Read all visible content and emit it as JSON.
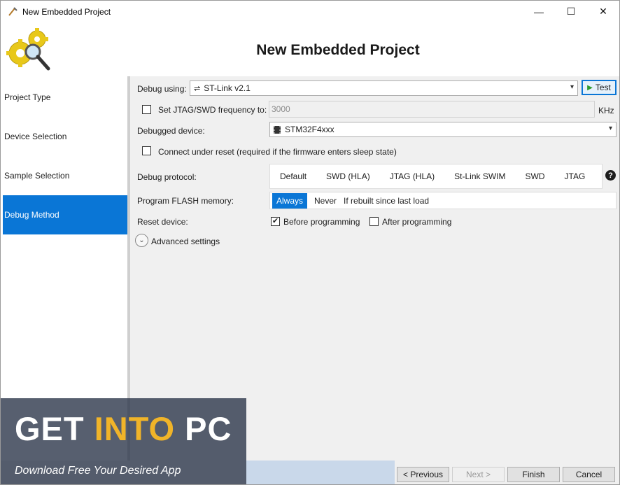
{
  "window": {
    "title": "New Embedded Project",
    "minimize": "—",
    "maximize": "☐",
    "close": "✕"
  },
  "header": {
    "heading": "New Embedded Project"
  },
  "sidebar": {
    "items": [
      {
        "label": "Project Type"
      },
      {
        "label": "Device Selection"
      },
      {
        "label": "Sample Selection"
      },
      {
        "label": "Debug Method",
        "active": true
      }
    ]
  },
  "debug_using": {
    "label": "Debug using:",
    "value": "ST-Link v2.1",
    "test_label": "Test"
  },
  "jtag_freq": {
    "label": "Set JTAG/SWD frequency to:",
    "value": "3000",
    "unit": "KHz",
    "checked": false
  },
  "debugged_device": {
    "label": "Debugged device:",
    "value": "STM32F4xxx"
  },
  "connect_reset": {
    "label": "Connect under reset (required if the firmware enters sleep state)",
    "checked": false
  },
  "debug_protocol": {
    "label": "Debug protocol:",
    "options": [
      "Default",
      "SWD (HLA)",
      "JTAG (HLA)",
      "St-Link SWIM",
      "SWD",
      "JTAG"
    ],
    "help": "?"
  },
  "program_flash": {
    "label": "Program FLASH memory:",
    "options": [
      "Always",
      "Never",
      "If rebuilt since last load"
    ],
    "selected": "Always"
  },
  "reset_device": {
    "label": "Reset device:",
    "before": {
      "label": "Before programming",
      "checked": true
    },
    "after": {
      "label": "After programming",
      "checked": false
    }
  },
  "advanced": {
    "label": "Advanced settings"
  },
  "footer": {
    "previous": "< Previous",
    "next": "Next >",
    "finish": "Finish",
    "cancel": "Cancel"
  },
  "watermark": {
    "text_a": "GET ",
    "text_b": "INTO",
    "text_c": " PC",
    "tagline": "Download Free Your Desired App"
  },
  "colors": {
    "accent": "#0a76d6",
    "watermark_highlight": "#f0b429"
  }
}
